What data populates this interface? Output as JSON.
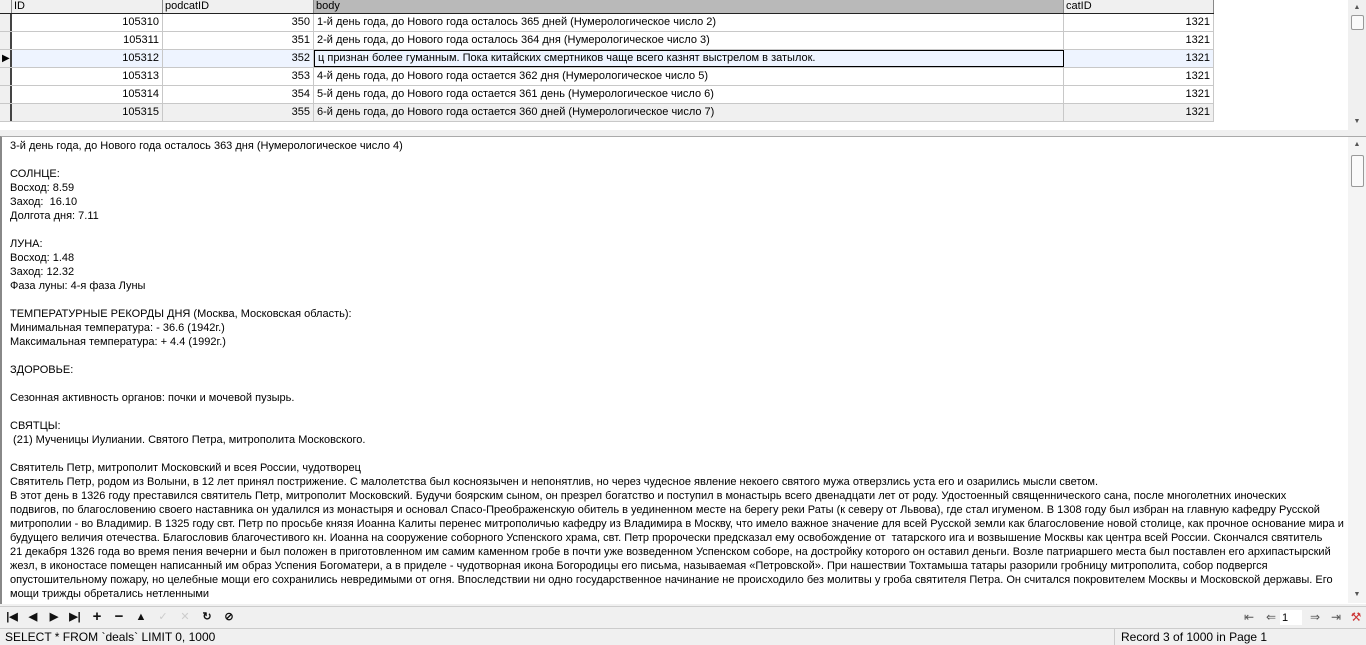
{
  "grid": {
    "columns": [
      "ID",
      "podcatID",
      "body",
      "catID"
    ],
    "rows": [
      {
        "id": "105310",
        "podcat": "350",
        "body": "1-й день года, до Нового года осталось 365 дней (Нумерологическое число 2)",
        "cat": "1321"
      },
      {
        "id": "105311",
        "podcat": "351",
        "body": "2-й день года, до Нового года осталось 364 дня (Нумерологическое число 3)",
        "cat": "1321"
      },
      {
        "id": "105312",
        "podcat": "352",
        "body": "ц признан более гуманным. Пока китайских смертников чаще всего казнят выстрелом в затылок.",
        "cat": "1321"
      },
      {
        "id": "105313",
        "podcat": "353",
        "body": "4-й день года, до Нового года остается 362 дня (Нумерологическое число 5)",
        "cat": "1321"
      },
      {
        "id": "105314",
        "podcat": "354",
        "body": "5-й день года, до Нового года остается 361 день (Нумерологическое число 6)",
        "cat": "1321"
      },
      {
        "id": "105315",
        "podcat": "355",
        "body": "6-й день года, до Нового года остается 360 дней (Нумерологическое число 7)",
        "cat": "1321"
      }
    ]
  },
  "detail": {
    "lines": [
      "3-й день года, до Нового года осталось 363 дня (Нумерологическое число 4)",
      "",
      "СОЛНЦЕ:",
      "Восход: 8.59",
      "Заход:  16.10",
      "Долгота дня: 7.11",
      "",
      "ЛУНА:",
      "Восход: 1.48",
      "Заход: 12.32",
      "Фаза луны: 4-я фаза Луны",
      "",
      "ТЕМПЕРАТУРНЫЕ РЕКОРДЫ ДНЯ (Москва, Московская область):",
      "Минимальная температура: - 36.6 (1942г.)",
      "Максимальная температура: + 4.4 (1992г.)",
      "",
      "ЗДОРОВЬЕ:",
      "",
      "Сезонная активность органов: почки и мочевой пузырь.",
      "",
      "СВЯТЦЫ:",
      " (21) Мученицы Иулиании. Святого Петра, митрополита Московского.",
      "",
      "Святитель Петр, митрополит Московский и всея России, чудотворец",
      "Святитель Петр, родом из Волыни, в 12 лет принял пострижение. С малолетства был косноязычен и непонятлив, но через чудесное явление некоего святого мужа отверзлись уста его и озарились мысли светом.",
      "В этот день в 1326 году преставился святитель Петр, митрополит Московский. Будучи боярским сыном, он презрел богатство и поступил в монастырь всего двенадцати лет от роду. Удостоенный священнического сана, после многолетних иноческих",
      "подвигов, по благословению своего наставника он удалился из монастыря и основал Спасо-Преображенскую обитель в уединенном месте на берегу реки Раты (к северу от Львова), где стал игуменом. В 1308 году был избран на главную кафедру Русской",
      "митрополии - во Владимир. В 1325 году свт. Петр по просьбе князя Иоанна Калиты перенес митрополичью кафедру из Владимира в Москву, что имело важное значение для всей Русской земли как благословение новой столице, как прочное основание мира и",
      "будущего величия отечества. Благословив благочестивого кн. Иоанна на сооружение соборного Успенского храма, свт. Петр пророчески предсказал ему освобождение от  татарского ига и возвышение Москвы как центра всей России. Скончался святитель",
      "21 декабря 1326 года во время пения вечерни и был положен в приготовленном им самим каменном гробе в почти уже возведенном Успенском соборе, на достройку которого он оставил деньги. Возле патриаршего места был поставлен его архипастырский",
      "жезл, в иконостасе помещен написанный им образ Успения Богоматери, а в приделе - чудотворная икона Богородицы его письма, называемая «Петровской». При нашествии Тохтамыша татары разорили гробницу митрополита, собор подвергся",
      "опустошительному пожару, но целебные мощи его сохранились невредимыми от огня. Впоследствии ни одно государственное начинание не происходило без молитвы у гроба святителя Петра. Он считался покровителем Москвы и Московской державы. Его",
      "мощи трижды обретались нетленными"
    ]
  },
  "pager": {
    "page_value": "1"
  },
  "status": {
    "query": "SELECT * FROM `deals` LIMIT 0, 1000",
    "record": "Record 3 of 1000 in Page 1"
  }
}
